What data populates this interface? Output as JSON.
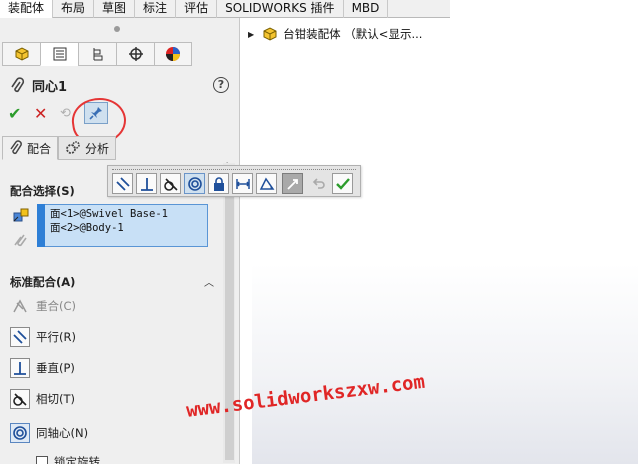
{
  "command_tabs": [
    "装配体",
    "布局",
    "草图",
    "标注",
    "评估",
    "SOLIDWORKS 插件",
    "MBD"
  ],
  "active_command_tab": "装配体",
  "manager_tabs": [
    "feature-manager",
    "property-manager",
    "configuration-manager",
    "dimxpert-manager",
    "display-manager"
  ],
  "property_manager": {
    "title": "同心1",
    "help": "?",
    "tabs": [
      {
        "label": "配合"
      },
      {
        "label": "分析"
      }
    ],
    "mate_selections": {
      "heading": "配合选择(S)",
      "items": [
        "面<1>@Swivel Base-1",
        "面<2>@Body-1"
      ]
    },
    "standard_mates": {
      "heading": "标准配合(A)",
      "items": [
        {
          "label": "重合(C)",
          "icon": "coincident-icon"
        },
        {
          "label": "平行(R)",
          "icon": "parallel-icon"
        },
        {
          "label": "垂直(P)",
          "icon": "perpendicular-icon"
        },
        {
          "label": "相切(T)",
          "icon": "tangent-icon"
        },
        {
          "label": "同轴心(N)",
          "icon": "concentric-icon"
        }
      ],
      "lock_rotation_label": "锁定旋转"
    }
  },
  "feature_tree": {
    "root_label": "台钳装配体 （默认<显示..."
  },
  "watermark": "www.solidworkszxw.com",
  "colors": {
    "accent": "#2e7fd6",
    "ok": "#2c9c2c",
    "cancel": "#cc2222",
    "annotation": "#e53535"
  }
}
